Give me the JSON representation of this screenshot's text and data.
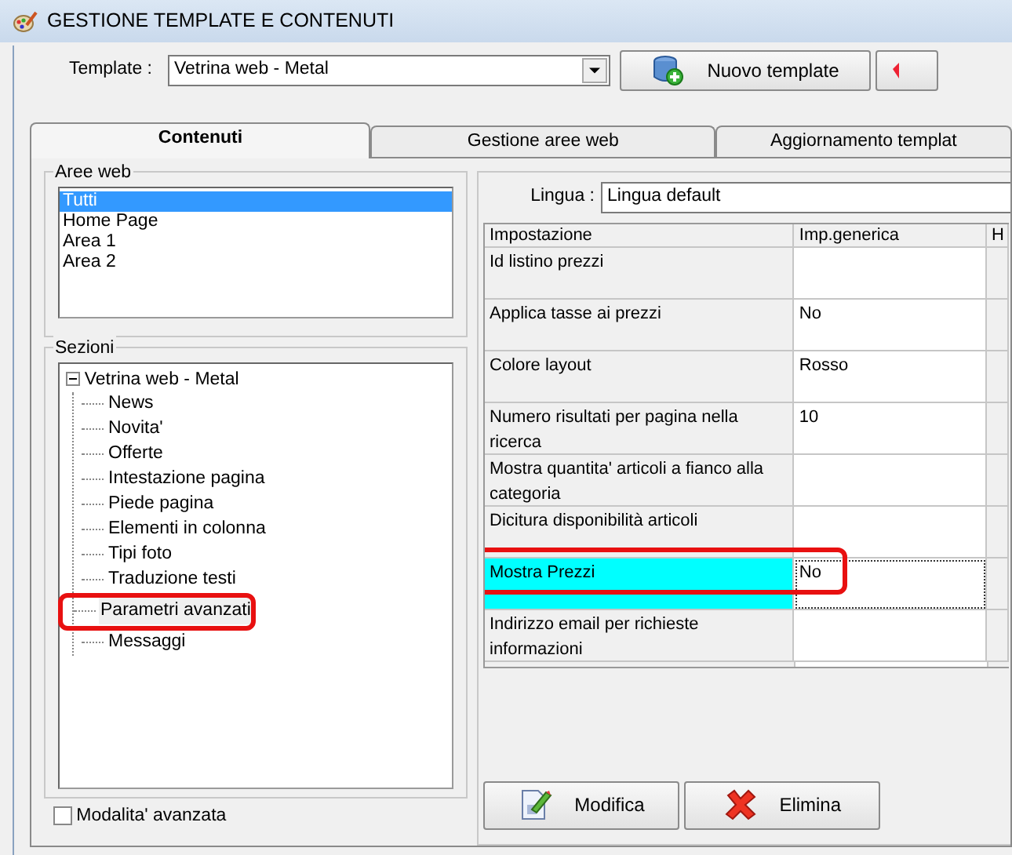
{
  "window": {
    "title": "GESTIONE TEMPLATE E CONTENUTI"
  },
  "template": {
    "label": "Template :",
    "value": "Vetrina web - Metal"
  },
  "top_buttons": [
    {
      "label": "Nuovo template",
      "kind": "new"
    },
    {
      "kind": "cut"
    }
  ],
  "tabs": [
    {
      "label": "Contenuti",
      "selected": true
    },
    {
      "label": "Gestione aree web",
      "selected": false
    },
    {
      "label": "Aggiornamento templat",
      "selected": false
    }
  ],
  "aree_web": {
    "legend": "Aree web",
    "items": [
      {
        "label": "Tutti",
        "selected": true
      },
      {
        "label": "Home Page",
        "selected": false
      },
      {
        "label": "Area 1",
        "selected": false
      },
      {
        "label": "Area 2",
        "selected": false
      }
    ]
  },
  "sezioni": {
    "legend": "Sezioni",
    "tree": {
      "label": "Vetrina web - Metal",
      "expanded": true,
      "children": [
        {
          "label": "News",
          "selected": false,
          "annotated": false
        },
        {
          "label": "Novita'",
          "selected": false,
          "annotated": false
        },
        {
          "label": "Offerte",
          "selected": false,
          "annotated": false
        },
        {
          "label": "Intestazione pagina",
          "selected": false,
          "annotated": false
        },
        {
          "label": "Piede pagina",
          "selected": false,
          "annotated": false
        },
        {
          "label": "Elementi in colonna",
          "selected": false,
          "annotated": false
        },
        {
          "label": "Tipi foto",
          "selected": false,
          "annotated": false
        },
        {
          "label": "Traduzione testi",
          "selected": false,
          "annotated": false
        },
        {
          "label": "Parametri avanzati",
          "selected": true,
          "annotated": true
        },
        {
          "label": "Messaggi",
          "selected": false,
          "annotated": false
        }
      ]
    }
  },
  "advanced_mode": {
    "label": "Modalita' avanzata",
    "checked": false
  },
  "lingua": {
    "label": "Lingua :",
    "value": "Lingua default"
  },
  "grid": {
    "columns": [
      "Impostazione",
      "Imp.generica",
      "H"
    ],
    "rows": [
      {
        "setting": "Id listino prezzi",
        "selected": false,
        "annotated": false
      },
      {
        "setting": "Applica tasse ai prezzi",
        "value": "No",
        "selected": false,
        "annotated": false
      },
      {
        "setting": "Colore layout",
        "value": "Rosso",
        "selected": false,
        "annotated": false
      },
      {
        "setting": "Numero risultati per pagina nella ricerca",
        "value": "10",
        "selected": false,
        "annotated": false
      },
      {
        "setting": "Mostra quantita' articoli a fianco alla categoria",
        "selected": false,
        "annotated": false
      },
      {
        "setting": "Dicitura disponibilità articoli",
        "selected": false,
        "annotated": false
      },
      {
        "setting": "Mostra Prezzi",
        "value": "No",
        "selected": true,
        "annotated": true
      },
      {
        "setting": "Indirizzo email per richieste informazioni",
        "selected": false,
        "annotated": false
      }
    ]
  },
  "actions": [
    {
      "label": "Modifica",
      "kind": "edit"
    },
    {
      "label": "Elimina",
      "kind": "delete"
    }
  ]
}
